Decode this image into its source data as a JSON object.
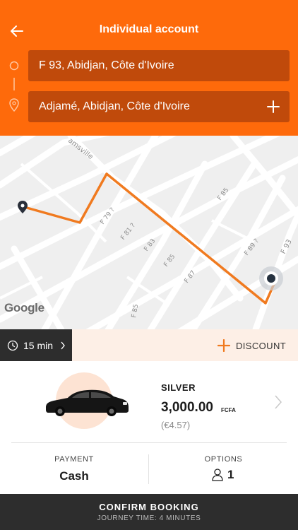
{
  "header": {
    "title": "Individual account",
    "back_icon": "arrow-left-icon",
    "pickup": "F 93, Abidjan, Côte d'Ivoire",
    "destination": "Adjamé, Abidjan, Côte d'Ivoire",
    "add_stop_icon": "plus-icon",
    "accent_color": "#fe6a0b"
  },
  "map": {
    "street_labels": [
      "amsville",
      "F 79 ?",
      "F 81 ?",
      "F 83",
      "F 85",
      "F 85",
      "F 85",
      "F 87",
      "F 89 ?",
      "F 93",
      "F 85"
    ],
    "route_color": "#f07a1f",
    "attribution": "Google"
  },
  "trip_bar": {
    "duration": "15 min",
    "discount_label": "DISCOUNT"
  },
  "vehicle": {
    "tier": "SILVER",
    "price": "3,000.00",
    "currency": "FCFA",
    "price_converted": "(€4.57)"
  },
  "payment": {
    "label": "PAYMENT",
    "value": "Cash"
  },
  "options": {
    "label": "OPTIONS",
    "passengers": "1"
  },
  "confirm": {
    "label": "CONFIRM BOOKING",
    "journey_time": "JOURNEY TIME: 4 MINUTES"
  }
}
